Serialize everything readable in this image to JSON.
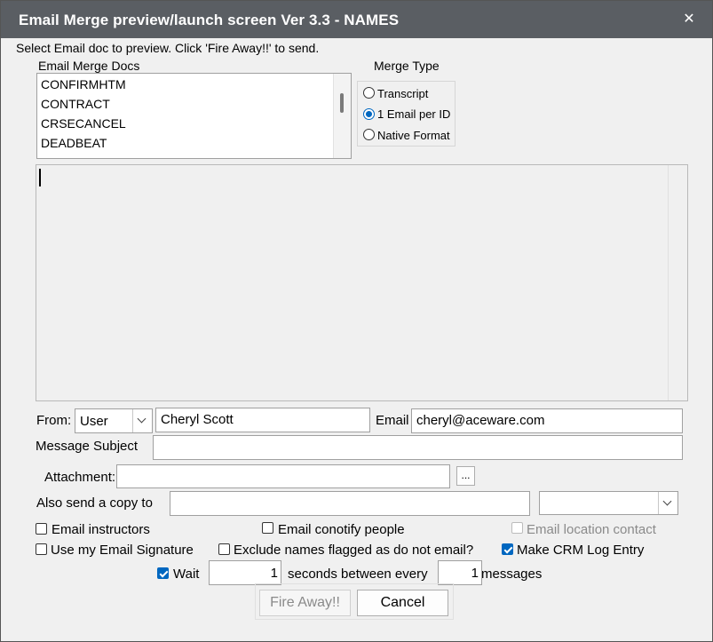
{
  "window": {
    "title": "Email Merge preview/launch screen Ver 3.3 - NAMES",
    "close_glyph": "✕"
  },
  "instructions": "Select  Email doc to preview.   Click 'Fire Away!!' to send.",
  "docs": {
    "label": "Email Merge Docs",
    "items": [
      "CONFIRMHTM",
      "CONTRACT",
      "CRSECANCEL",
      "DEADBEAT"
    ]
  },
  "merge_type": {
    "label": "Merge Type",
    "options": [
      {
        "label": "Transcript",
        "selected": false
      },
      {
        "label": "1 Email per ID",
        "selected": true
      },
      {
        "label": "Native Format",
        "selected": false
      }
    ]
  },
  "preview": {
    "text": ""
  },
  "from": {
    "label": "From:",
    "type_value": "User",
    "name_value": "Cheryl Scott",
    "email_label": "Email",
    "email_value": "cheryl@aceware.com"
  },
  "subject": {
    "label": "Message Subject",
    "value": ""
  },
  "attachment": {
    "label": "Attachment:",
    "value": "",
    "browse_label": "..."
  },
  "copy_to": {
    "label": "Also send a copy to",
    "value": "",
    "type_value": ""
  },
  "options": {
    "email_instructors": {
      "label": "Email instructors",
      "checked": false
    },
    "email_conotify": {
      "label": "Email conotify people",
      "checked": false
    },
    "email_location": {
      "label": "Email location contact",
      "checked": false,
      "disabled": true
    },
    "use_signature": {
      "label": "Use my Email Signature",
      "checked": false
    },
    "exclude_flagged": {
      "label": "Exclude names flagged as do not email?",
      "checked": false
    },
    "crm_log": {
      "label": "Make CRM Log Entry",
      "checked": true
    }
  },
  "throttle": {
    "wait_label": "Wait",
    "wait_checked": true,
    "seconds_value": "1",
    "between_label": "seconds between every",
    "messages_value": "1",
    "messages_label": "messages"
  },
  "buttons": {
    "fire": "Fire Away!!",
    "cancel": "Cancel"
  },
  "colors": {
    "titlebar": "#5a5e63",
    "accent": "#0067c0",
    "background": "#f0f0f0"
  },
  "icons": {
    "close": "close-icon",
    "dropdown": "chevron-down-icon"
  }
}
